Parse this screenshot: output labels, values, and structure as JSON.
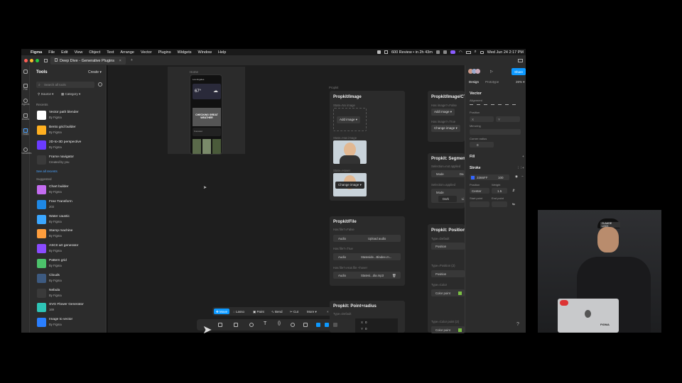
{
  "menubar": {
    "items": [
      "Figma",
      "File",
      "Edit",
      "View",
      "Object",
      "Text",
      "Arrange",
      "Vector",
      "Plugins",
      "Widgets",
      "Window",
      "Help"
    ],
    "status": "600 Review • in 2h 43m",
    "datetime": "Wed Jun 24  2:17 PM"
  },
  "tab": {
    "title": "Deep Dive - Generative Plugins",
    "add": "+"
  },
  "rail": [
    "File",
    "Agents",
    "Assets",
    "Tools",
    "Variables"
  ],
  "left": {
    "title": "Tools",
    "create": "Create",
    "search_placeholder": "Search all tools",
    "filters": [
      "Source",
      "Category"
    ],
    "recents_label": "Recents",
    "recents": [
      {
        "name": "Vector path blender",
        "by": "By Figma",
        "color": "#ffffff"
      },
      {
        "name": "Bento grid builder",
        "by": "By Figma",
        "color": "#ffb020"
      },
      {
        "name": "2D-to-3D perspective",
        "by": "By Figma",
        "color": "#6b3bff"
      },
      {
        "name": "Frame navigator",
        "by": "Created by you",
        "color": "#3a3a3a"
      }
    ],
    "see_all": "See all recents",
    "suggested_label": "Suggested",
    "suggested": [
      {
        "name": "Chart builder",
        "by": "By Figma",
        "color": "#c36cf0"
      },
      {
        "name": "Free Transform",
        "by": "203",
        "color": "#1e88e5"
      },
      {
        "name": "Water caustic",
        "by": "By Figma",
        "color": "#3ba7ff"
      },
      {
        "name": "Stamp machine",
        "by": "By Figma",
        "color": "#ff9e3d"
      },
      {
        "name": "ASCII art generator",
        "by": "By Figma",
        "color": "#8a4bff"
      },
      {
        "name": "Pattern grid",
        "by": "By Figma",
        "color": "#4cc26b"
      },
      {
        "name": "Clouds",
        "by": "By Figma",
        "color": "#3d5a80"
      },
      {
        "name": "Nebula",
        "by": "By Figma",
        "color": "#3a3a3a"
      },
      {
        "name": "SVG Flower Generator",
        "by": "169",
        "color": "#2ec4b6"
      },
      {
        "name": "Image to vector",
        "by": "By Figma",
        "color": "#2a7fff"
      }
    ]
  },
  "canvas": {
    "frame_label": "Home",
    "section_label": "Propkit",
    "phone": {
      "location": "Los Angeles",
      "temp": "67°",
      "hero": "CHECKING GREAT WEATHER",
      "sub": "Forecast"
    },
    "cards": {
      "image": {
        "title": "Propkit/Image",
        "state1": "State=No image",
        "btn1": "Add image",
        "state2": "State=Has image",
        "state3": "State=Hover",
        "btn3": "Change image"
      },
      "image_ct": {
        "title": "Propkit/Image/CT",
        "l1": "Has image?=False",
        "btn1": "Add image",
        "l2": "Has image?=True",
        "btn2": "Change image"
      },
      "segment": {
        "title": "Propkit: Segment",
        "l1": "Selection=not applied",
        "r1a": "Mode",
        "r1b": "Da",
        "l2": "Selection=applied",
        "r2a": "Mode",
        "r2b": "Dark",
        "r2c": "Li"
      },
      "file": {
        "title": "Propkit/File",
        "l1": "Has file?=False",
        "r1a": "Audio",
        "r1b": "Upload audio",
        "l2": "Has file?=True",
        "r2a": "Audio",
        "r2b": "Stateside...Bladee.m...",
        "l3": "Has file?=Has file +hover",
        "r3a": "Audio",
        "r3b": "Statesi...dia.mp3"
      },
      "position": {
        "title": "Propkit: Position",
        "l1": "Type=Default",
        "r1": "Position",
        "l2": "Type=Position (2)",
        "r2": "Position",
        "l3": "Type=Color",
        "r3": "Color point",
        "l4": "Type=Color point (2)",
        "r4": "Color point"
      },
      "point": {
        "title": "Propkit: Point+radius",
        "l1": "Type=Default"
      }
    },
    "coords": {
      "x": "X",
      "xv": "0",
      "y": "Y",
      "yv": "0"
    }
  },
  "modebar": [
    "Move",
    "Lasso",
    "Paint",
    "Bend",
    "Cut",
    "More"
  ],
  "right": {
    "tabs": [
      "Design",
      "Prototype"
    ],
    "zoom": "26%",
    "share": "Share",
    "section": "Vector",
    "alignment": "Alignment",
    "position": "Position",
    "x": "X",
    "y": "Y",
    "mirroring": "Mirroring",
    "corner": "Corner radius",
    "corner_val": "0",
    "fill": "Fill",
    "stroke": "Stroke",
    "stroke_hex": "3366FF",
    "stroke_opacity": "100",
    "stroke_pos_label": "Position",
    "stroke_weight_label": "Weight",
    "stroke_pos": "Center",
    "stroke_weight": "1.5",
    "start": "Start point",
    "end": "End point",
    "help": "?",
    "stroke_color": "#3366ff"
  },
  "video": {
    "cap": "CLAUDE LOCK",
    "laptop": "FIGMA"
  }
}
